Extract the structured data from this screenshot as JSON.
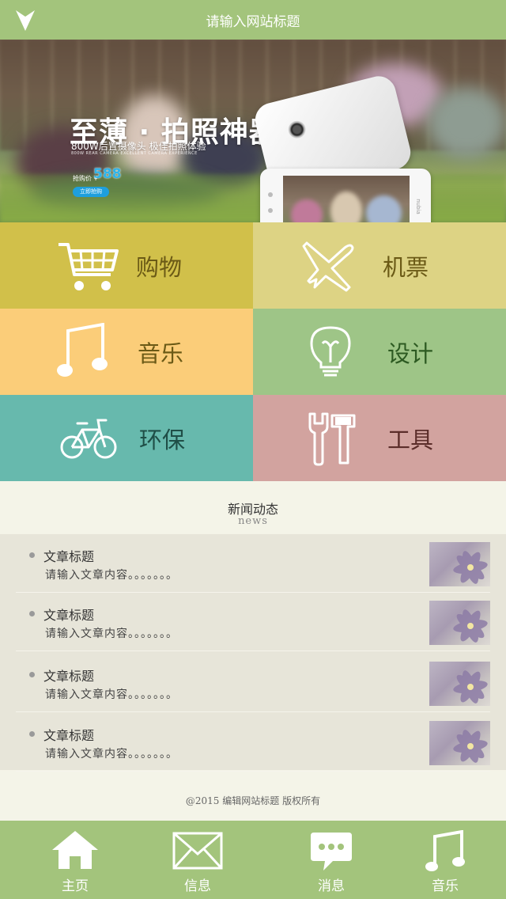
{
  "header": {
    "title": "请输入网站标题",
    "logo_icon": "v-arrow-logo-icon"
  },
  "banner": {
    "headline": "至薄 · 拍照神器",
    "subline": "800W后置摄像头  极佳拍照体验",
    "tagline": "800W REAR CAMERA EXCELLENT CAMERA EXPERIENCE",
    "price_label": "抢购价 ¥",
    "price": "588",
    "buy_label": "立即抢购",
    "phone_brand": "nubia"
  },
  "categories": [
    {
      "label": "购物",
      "icon": "shopping-cart-icon",
      "bg": "#d1c04a",
      "color": "#6b5a16"
    },
    {
      "label": "机票",
      "icon": "airplane-icon",
      "bg": "#ddd384",
      "color": "#6b5a16"
    },
    {
      "label": "音乐",
      "icon": "music-note-icon",
      "bg": "#fbcd79",
      "color": "#6b5a16"
    },
    {
      "label": "设计",
      "icon": "lightbulb-icon",
      "bg": "#9ec587",
      "color": "#2d5a22"
    },
    {
      "label": "环保",
      "icon": "bicycle-icon",
      "bg": "#67b9ad",
      "color": "#1f4e47"
    },
    {
      "label": "工具",
      "icon": "tools-icon",
      "bg": "#d2a39f",
      "color": "#5b2d2a"
    }
  ],
  "news": {
    "title": "新闻动态",
    "subtitle": "news",
    "items": [
      {
        "title": "文章标题",
        "text": "请输入文章内容。。。。。。。"
      },
      {
        "title": "文章标题",
        "text": "请输入文章内容。。。。。。。"
      },
      {
        "title": "文章标题",
        "text": "请输入文章内容。。。。。。。"
      },
      {
        "title": "文章标题",
        "text": "请输入文章内容。。。。。。。"
      }
    ]
  },
  "footer": {
    "copyright": "@2015 编辑网站标题 版权所有"
  },
  "tabbar": {
    "items": [
      {
        "label": "主页",
        "icon": "home-icon"
      },
      {
        "label": "信息",
        "icon": "mail-icon"
      },
      {
        "label": "消息",
        "icon": "chat-bubble-icon"
      },
      {
        "label": "音乐",
        "icon": "music-note-icon"
      }
    ]
  },
  "colors": {
    "header_bg": "#a3c47c",
    "page_bg": "#f4f4e8",
    "news_bg": "#e7e5d9"
  }
}
